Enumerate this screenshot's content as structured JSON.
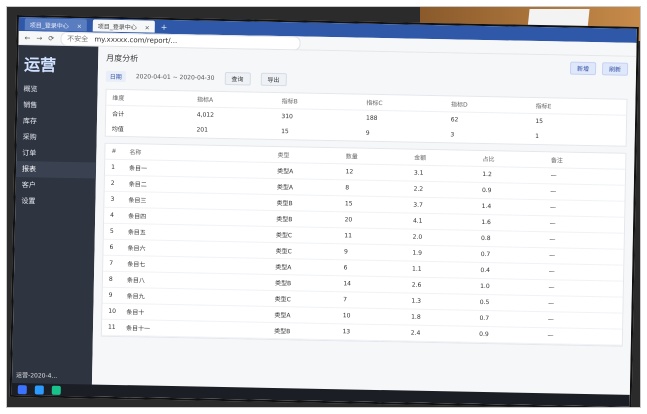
{
  "browser": {
    "tabs": [
      {
        "label": "项目_登录中心"
      },
      {
        "label": "项目_登录中心"
      }
    ],
    "address": {
      "prefix": "不安全",
      "url": "my.xxxxx.com/report/..."
    }
  },
  "sidebar": {
    "logo": "运营",
    "items": [
      {
        "label": "概览"
      },
      {
        "label": "销售"
      },
      {
        "label": "库存"
      },
      {
        "label": "采购"
      },
      {
        "label": "订单"
      },
      {
        "label": "报表"
      },
      {
        "label": "客户"
      },
      {
        "label": "设置"
      }
    ]
  },
  "main": {
    "title": "月度分析",
    "filters": {
      "range_label": "日期",
      "range_value": "2020-04-01 ~ 2020-04-30",
      "query_button": "查询",
      "export_button": "导出"
    },
    "right_actions": [
      {
        "label": "新增"
      },
      {
        "label": "刷新"
      }
    ],
    "summary": {
      "headers": [
        "维度",
        "指标A",
        "指标B",
        "指标C",
        "指标D",
        "指标E"
      ],
      "rows": [
        [
          "合计",
          "4,012",
          "310",
          "188",
          "62",
          "15"
        ],
        [
          "均值",
          "201",
          "15",
          "9",
          "3",
          "1"
        ]
      ]
    },
    "table": {
      "headers": [
        "#",
        "名称",
        "类型",
        "数量",
        "金额",
        "占比",
        "备注"
      ],
      "rows": [
        [
          "1",
          "条目一",
          "类型A",
          "12",
          "3.1",
          "1.2",
          "—"
        ],
        [
          "2",
          "条目二",
          "类型A",
          "8",
          "2.2",
          "0.9",
          "—"
        ],
        [
          "3",
          "条目三",
          "类型B",
          "15",
          "3.7",
          "1.4",
          "—"
        ],
        [
          "4",
          "条目四",
          "类型B",
          "20",
          "4.1",
          "1.6",
          "—"
        ],
        [
          "5",
          "条目五",
          "类型C",
          "11",
          "2.0",
          "0.8",
          "—"
        ],
        [
          "6",
          "条目六",
          "类型C",
          "9",
          "1.9",
          "0.7",
          "—"
        ],
        [
          "7",
          "条目七",
          "类型A",
          "6",
          "1.1",
          "0.4",
          "—"
        ],
        [
          "8",
          "条目八",
          "类型B",
          "14",
          "2.6",
          "1.0",
          "—"
        ],
        [
          "9",
          "条目九",
          "类型C",
          "7",
          "1.3",
          "0.5",
          "—"
        ],
        [
          "10",
          "条目十",
          "类型A",
          "10",
          "1.8",
          "0.7",
          "—"
        ],
        [
          "11",
          "条目十一",
          "类型B",
          "13",
          "2.4",
          "0.9",
          "—"
        ]
      ]
    }
  },
  "taskbar": {
    "download_label": "运营-2020-4..."
  }
}
